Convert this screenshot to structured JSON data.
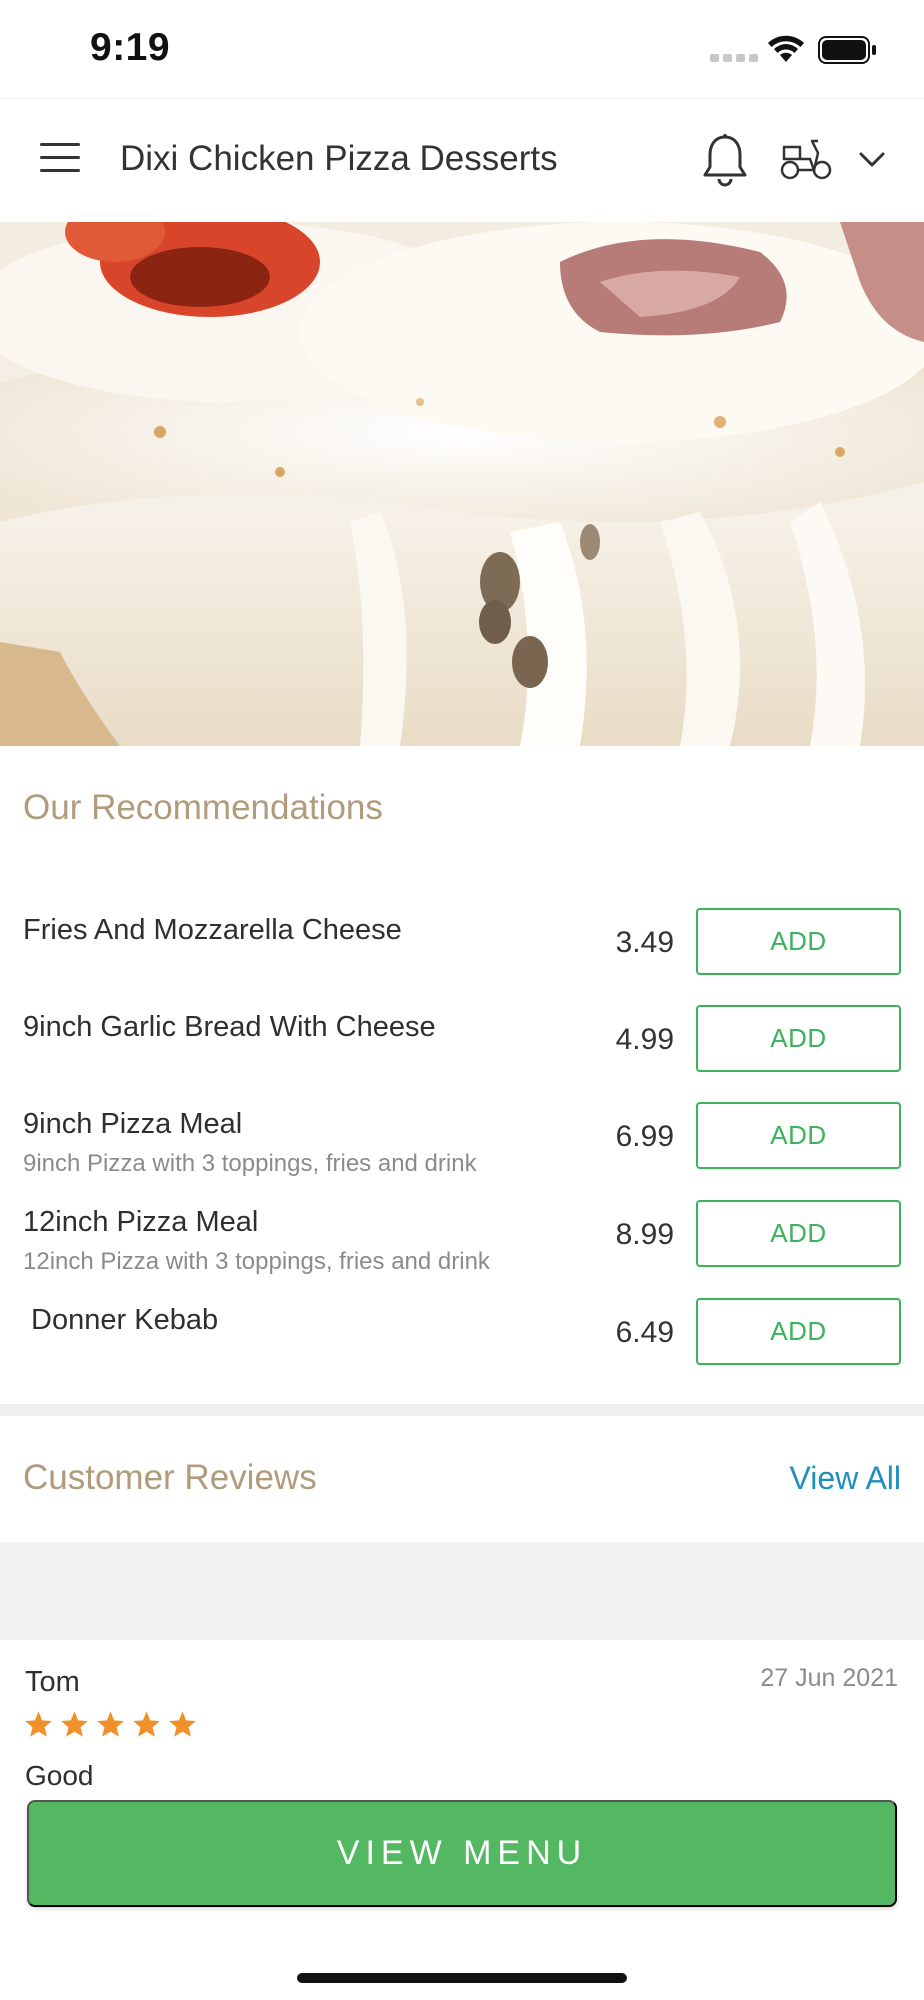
{
  "status_bar": {
    "time": "9:19"
  },
  "header": {
    "title": "Dixi Chicken Pizza Desserts"
  },
  "recommendations": {
    "title": "Our Recommendations",
    "items": [
      {
        "name": "Fries And Mozzarella Cheese",
        "desc": "",
        "price": "3.49",
        "button": "ADD"
      },
      {
        "name": "9inch Garlic Bread With Cheese",
        "desc": "",
        "price": "4.99",
        "button": "ADD"
      },
      {
        "name": "9inch Pizza Meal",
        "desc": "9inch Pizza with 3 toppings, fries and drink",
        "price": "6.99",
        "button": "ADD"
      },
      {
        "name": "12inch Pizza Meal",
        "desc": "12inch Pizza with 3 toppings, fries and drink",
        "price": "8.99",
        "button": "ADD"
      },
      {
        "name": " Donner Kebab",
        "desc": "",
        "price": "6.49",
        "button": "ADD"
      }
    ]
  },
  "reviews": {
    "title": "Customer Reviews",
    "view_all": "View All",
    "items": [
      {
        "name": "Tom",
        "date": "27 Jun 2021",
        "rating": 5,
        "text": "Good"
      }
    ]
  },
  "bottom": {
    "view_menu": "VIEW MENU"
  },
  "colors": {
    "accent_green": "#3bb25b",
    "section_title": "#b09b7c",
    "link_blue": "#1f8fbf",
    "star": "#f0902a"
  }
}
